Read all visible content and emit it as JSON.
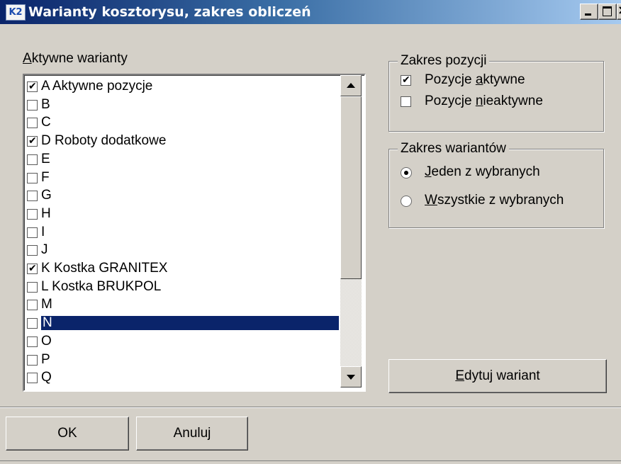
{
  "window": {
    "title": "Warianty kosztorysu, zakres obliczeń",
    "app_icon_text": "K2"
  },
  "list": {
    "label_prefix": "",
    "label_underlined": "A",
    "label_rest": "ktywne warianty",
    "items": [
      {
        "text": "A Aktywne pozycje",
        "checked": true
      },
      {
        "text": "B",
        "checked": false
      },
      {
        "text": "C",
        "checked": false
      },
      {
        "text": "D Roboty dodatkowe",
        "checked": true
      },
      {
        "text": "E",
        "checked": false
      },
      {
        "text": "F",
        "checked": false
      },
      {
        "text": "G",
        "checked": false
      },
      {
        "text": "H",
        "checked": false
      },
      {
        "text": "I",
        "checked": false
      },
      {
        "text": "J",
        "checked": false
      },
      {
        "text": "K Kostka GRANITEX",
        "checked": true
      },
      {
        "text": "L Kostka BRUKPOL",
        "checked": false
      },
      {
        "text": "M",
        "checked": false
      },
      {
        "text": "N",
        "checked": false,
        "selected": true
      },
      {
        "text": "O",
        "checked": false
      },
      {
        "text": "P",
        "checked": false
      },
      {
        "text": "Q",
        "checked": false
      }
    ]
  },
  "zakres_pozycji": {
    "legend": "Zakres pozycji",
    "opt1": {
      "pre": "Pozycje ",
      "u": "a",
      "post": "ktywne",
      "checked": true
    },
    "opt2": {
      "pre": "Pozycje ",
      "u": "n",
      "post": "ieaktywne",
      "checked": false
    }
  },
  "zakres_wariantow": {
    "legend": "Zakres wariantów",
    "opt1": {
      "pre": "",
      "u": "J",
      "post": "eden z wybranych",
      "selected": true
    },
    "opt2": {
      "pre": "",
      "u": "W",
      "post": "szystkie z wybranych",
      "selected": false
    }
  },
  "buttons": {
    "edit": {
      "pre": "",
      "u": "E",
      "post": "dytuj wariant"
    },
    "ok": "OK",
    "cancel": "Anuluj"
  }
}
